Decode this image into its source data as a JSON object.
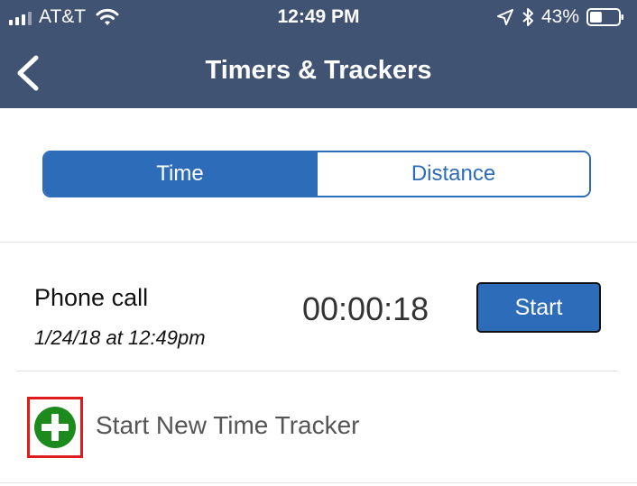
{
  "status_bar": {
    "carrier": "AT&T",
    "time": "12:49 PM",
    "battery": "43%",
    "battery_level": 0.43
  },
  "nav": {
    "title": "Timers & Trackers"
  },
  "tabs": [
    {
      "label": "Time",
      "active": true
    },
    {
      "label": "Distance",
      "active": false
    }
  ],
  "tracker": {
    "name": "Phone call",
    "date": "1/24/18 at 12:49pm",
    "elapsed": "00:00:18",
    "start_label": "Start"
  },
  "add_tracker": {
    "label": "Start New Time Tracker"
  },
  "colors": {
    "header": "#415372",
    "accent": "#2c6cb8",
    "add_icon": "#1c8a1c",
    "highlight": "#e01b1b"
  }
}
